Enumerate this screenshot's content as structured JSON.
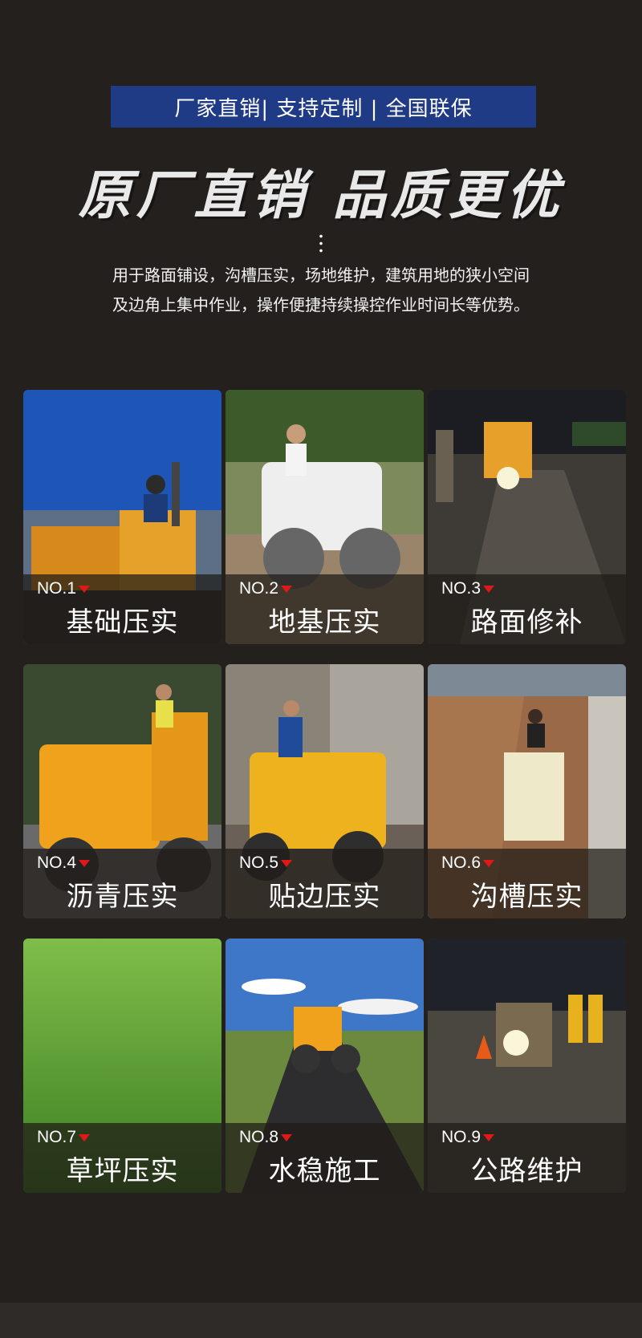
{
  "banner": {
    "text": "厂家直销| 支持定制 | 全国联保"
  },
  "headline": {
    "text": "原厂直销  品质更优"
  },
  "description": {
    "line1": "用于路面铺设，沟槽压实，场地维护，建筑用地的狭小空间",
    "line2": "及边角上集中作业，操作便捷持续操控作业时间长等优势。"
  },
  "cards": [
    {
      "no": "NO.1",
      "title": "基础压实"
    },
    {
      "no": "NO.2",
      "title": "地基压实"
    },
    {
      "no": "NO.3",
      "title": "路面修补"
    },
    {
      "no": "NO.4",
      "title": "沥青压实"
    },
    {
      "no": "NO.5",
      "title": "贴边压实"
    },
    {
      "no": "NO.6",
      "title": "沟槽压实"
    },
    {
      "no": "NO.7",
      "title": "草坪压实"
    },
    {
      "no": "NO.8",
      "title": "水稳施工"
    },
    {
      "no": "NO.9",
      "title": "公路维护"
    }
  ],
  "colors": {
    "background": "#24201e",
    "banner": "#1f3b86",
    "marker": "#e01818",
    "roller_yellow": "#f0a21d"
  }
}
